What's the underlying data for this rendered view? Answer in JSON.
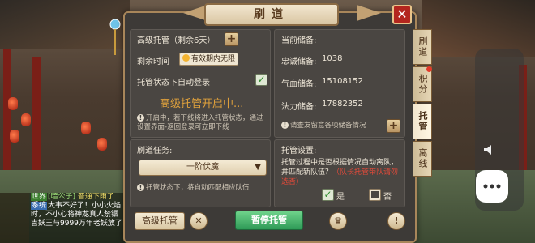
{
  "dialog": {
    "title": "刷道",
    "close": "✕"
  },
  "trust": {
    "header": "高级托管（剩余6天）",
    "remaining_label": "剩余时间",
    "remaining_value": "有效期内无限",
    "auto_login_label": "托管状态下自动登录",
    "auto_login_checked": true,
    "status": "高级托管开启中...",
    "note": "开启中，若下线将进入托管状态，通过设置界面-返回登录可立即下线"
  },
  "reserve": {
    "header": "当前储备:",
    "items": [
      {
        "label": "忠诚储备:",
        "value": "1038"
      },
      {
        "label": "气血储备:",
        "value": "15108152"
      },
      {
        "label": "法力储备:",
        "value": "17882352"
      }
    ],
    "note": "请查友留意各项储备情况"
  },
  "task": {
    "header": "刷道任务:",
    "selected": "一阶伏魔",
    "note": "托管状态下，将自动匹配相应队伍"
  },
  "settings": {
    "header": "托管设置:",
    "question": "托管过程中是否根据情况自动离队，并匹配新队伍？",
    "question_red": "（队长托管带队请勿选否）",
    "yes": "是",
    "no": "否",
    "yes_checked": true
  },
  "buttons": {
    "trust": "高级托管",
    "pause": "暂停托管",
    "cancel_icon": "✕",
    "gift_icon": "♛",
    "info_icon": "!"
  },
  "tabs": [
    "刷道",
    "积分",
    "托管",
    "离线"
  ],
  "active_tab": 2,
  "chat": {
    "lines": [
      {
        "tag": "世界",
        "text": "[暗公子]",
        "rest": "普通下雨了"
      },
      {
        "tag2": "",
        "text": "大事不好了！小小火焰"
      },
      {
        "tag2": "",
        "text": "时，不小心将神龙真人禁锢"
      },
      {
        "tag2": "",
        "text": "吉妖王与9999万年老妖放了"
      }
    ]
  },
  "icons": {
    "volume": "volume-icon",
    "more": "more-icon"
  }
}
